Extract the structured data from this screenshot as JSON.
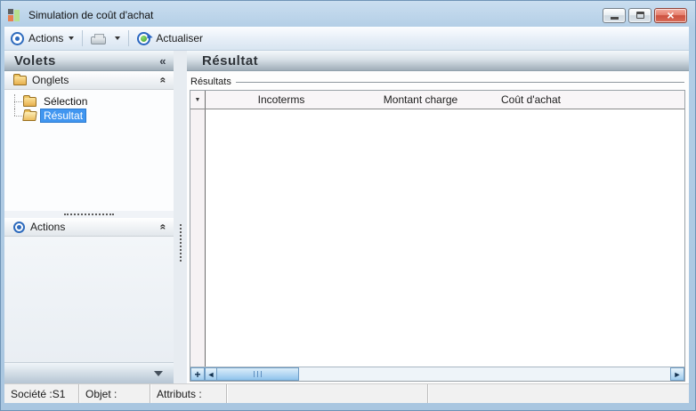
{
  "window": {
    "title": "Simulation de coût d'achat",
    "close_glyph": "×"
  },
  "toolbar": {
    "actions_label": "Actions",
    "refresh_label": "Actualiser"
  },
  "sidebar": {
    "title": "Volets",
    "collapse_glyph": "«",
    "section_collapse_glyph": "«",
    "sections": [
      {
        "label": "Onglets",
        "items": [
          {
            "label": "Sélection",
            "selected": false
          },
          {
            "label": "Résultat",
            "selected": true
          }
        ]
      },
      {
        "label": "Actions",
        "items": []
      }
    ]
  },
  "main": {
    "title": "Résultat",
    "group_label": "Résultats",
    "table": {
      "gutter_glyph": "▼",
      "columns": [
        "Incoterms",
        "Montant charge",
        "Coût d'achat"
      ],
      "rows": []
    },
    "scrollbar": {
      "plus_label": "+",
      "left_glyph": "◄",
      "right_glyph": "►"
    }
  },
  "statusbar": {
    "fields": [
      {
        "label": "Société :S1"
      },
      {
        "label": "Objet :"
      },
      {
        "label": "Attributs :"
      }
    ]
  },
  "colors": {
    "titlebar_blue": "#a9c6e0",
    "accent_blue": "#2e6bbd",
    "selection_blue": "#4196f0",
    "close_red": "#cc5240",
    "folder_yellow": "#e7af4d",
    "scrollbar_blue": "#8fc3ec"
  }
}
